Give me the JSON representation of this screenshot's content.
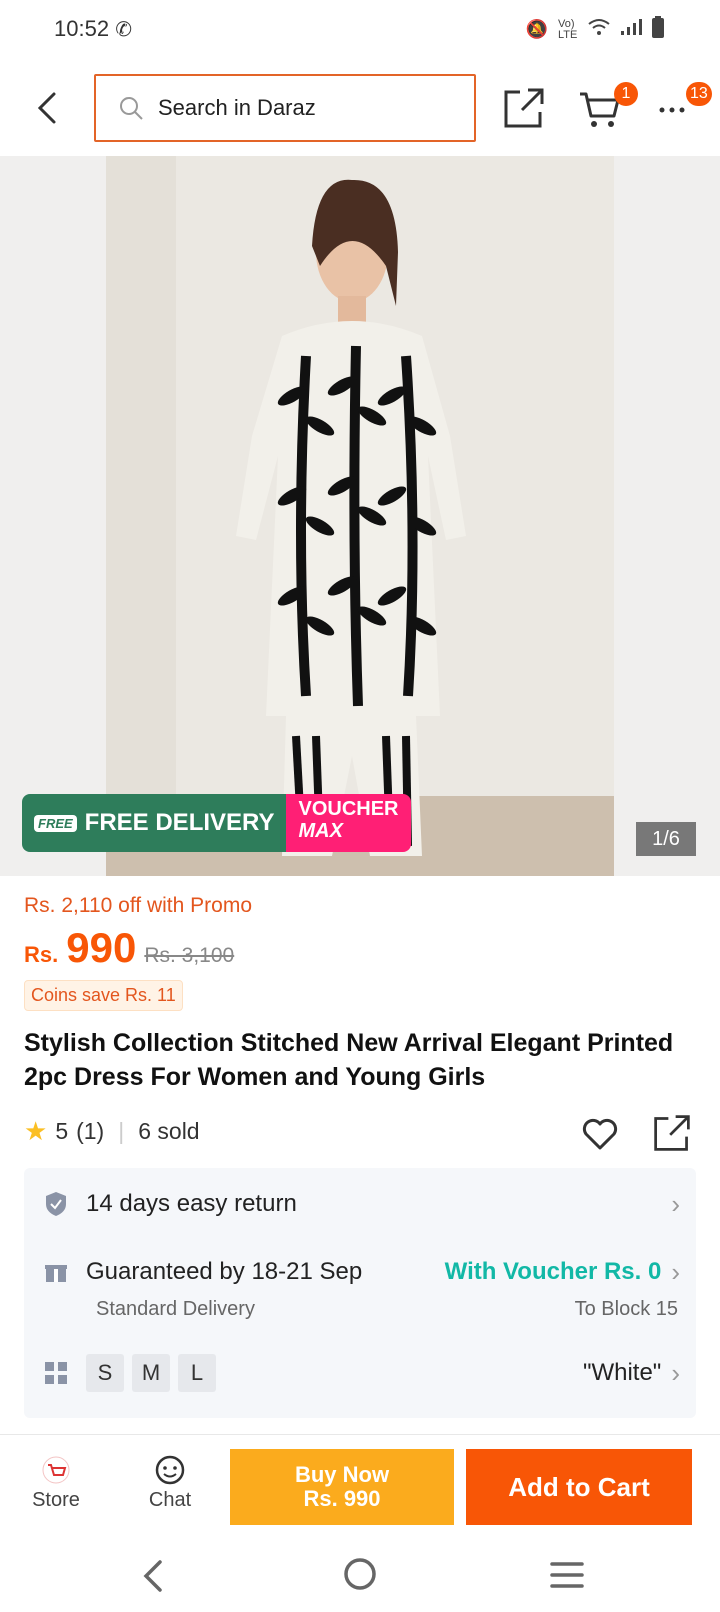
{
  "status_bar": {
    "time": "10:52",
    "network": "Vo) LTE"
  },
  "header": {
    "search_placeholder": "Search in Daraz",
    "cart_badge": "1",
    "more_badge": "13"
  },
  "gallery": {
    "counter": "1/6",
    "free_delivery_label": "FREE DELIVERY",
    "free_tag": "FREE",
    "voucher_label_line1": "VOUCHER",
    "voucher_label_line2": "MAX"
  },
  "price": {
    "promo_text": "Rs. 2,110 off with Promo",
    "currency": "Rs.",
    "current": "990",
    "original": "Rs. 3,100",
    "coins": "Coins save Rs. 11"
  },
  "product": {
    "title": "Stylish Collection Stitched New Arrival Elegant Printed 2pc Dress For Women and Young Girls",
    "rating": "5",
    "rating_count": "(1)",
    "sold": "6 sold"
  },
  "info": {
    "return_text": "14 days easy return",
    "delivery_text": "Guaranteed by 18-21 Sep",
    "delivery_sub": "Standard Delivery",
    "voucher_text": "With Voucher Rs. 0",
    "location": "To Block 15",
    "sizes": [
      "S",
      "M",
      "L"
    ],
    "color": "\"White\""
  },
  "bottom_bar": {
    "store_label": "Store",
    "chat_label": "Chat",
    "buy_now_line1": "Buy Now",
    "buy_now_line2": "Rs. 990",
    "add_to_cart": "Add to Cart"
  },
  "colors": {
    "accent": "#f85606",
    "voucher_teal": "#12b8a6",
    "buy_now": "#fbab1d"
  }
}
